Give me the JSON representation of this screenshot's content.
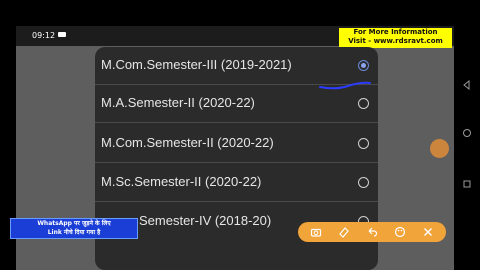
{
  "status_bar": {
    "time": "09:12"
  },
  "info_banner": {
    "line1": "For More Information",
    "line2": "Visit - www.rdsravt.com"
  },
  "dialog": {
    "options": [
      {
        "label": "M.Com.Semester-III (2019-2021)",
        "selected": true
      },
      {
        "label": "M.A.Semester-II (2020-22)",
        "selected": false
      },
      {
        "label": "M.Com.Semester-II (2020-22)",
        "selected": false
      },
      {
        "label": "M.Sc.Semester-II (2020-22)",
        "selected": false
      },
      {
        "label": "Semester-IV (2018-20)",
        "selected": false
      }
    ]
  },
  "whatsapp_banner": {
    "line1": "WhatsApp पर जुड़ने के लिए",
    "line2": "Link नीचे दिया गया है"
  },
  "toolbar": {
    "icons": [
      "camera-icon",
      "eraser-icon",
      "undo-icon",
      "palette-icon",
      "close-icon"
    ]
  },
  "colors": {
    "toolbar": "#f0a43a",
    "banner": "#ffff00",
    "whatsapp": "#1b3fd6",
    "dialog": "#2b2b2b"
  }
}
